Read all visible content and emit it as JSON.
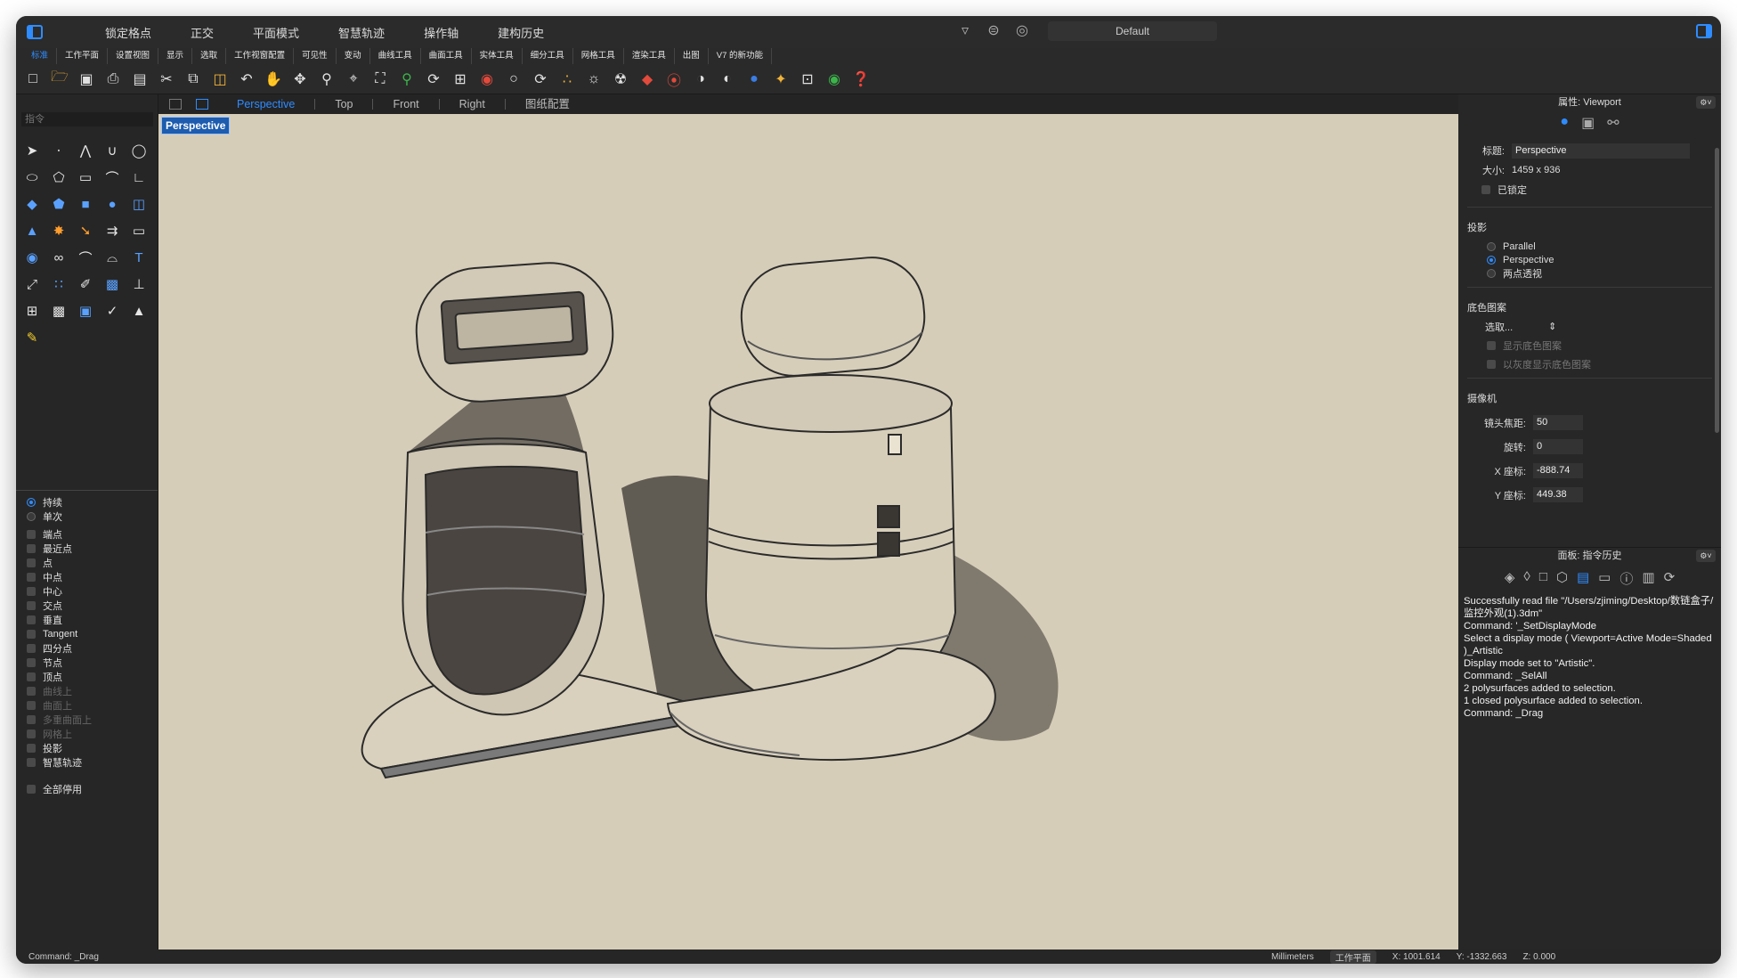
{
  "titlebar": {
    "menu": [
      "锁定格点",
      "正交",
      "平面模式",
      "智慧轨迹",
      "操作轴",
      "建构历史"
    ],
    "preset": "Default"
  },
  "tabs": [
    "标准",
    "工作平面",
    "设置视图",
    "显示",
    "选取",
    "工作视窗配置",
    "可见性",
    "变动",
    "曲线工具",
    "曲面工具",
    "实体工具",
    "细分工具",
    "网格工具",
    "渲染工具",
    "出图",
    "V7 的新功能"
  ],
  "toolbar_icons": [
    "new-icon",
    "open-icon",
    "save-icon",
    "print-icon",
    "paste-icon",
    "cut-icon",
    "copy-icon",
    "clipboard-icon",
    "undo-icon",
    "pan-hand-icon",
    "rotate-view-icon",
    "zoom-icon",
    "zoom-window-icon",
    "zoom-extents-icon",
    "zoom-selected-icon",
    "undo-view-icon",
    "four-viewports-icon",
    "car-icon",
    "car-shaded-icon",
    "rotate-icon",
    "points-icon",
    "light-icon",
    "lock-icon",
    "material-icon",
    "color-wheel-icon",
    "sphere-icon",
    "render-sphere-icon",
    "blue-sphere-icon",
    "plugin-icon",
    "grid-snap-icon",
    "globe-icon",
    "help-icon"
  ],
  "left": {
    "command_placeholder": "指令",
    "snap_modes": [
      {
        "label": "持续",
        "type": "radio",
        "on": true
      },
      {
        "label": "单次",
        "type": "radio",
        "on": false
      }
    ],
    "osnaps": [
      {
        "label": "端点",
        "dim": false
      },
      {
        "label": "最近点",
        "dim": false
      },
      {
        "label": "点",
        "dim": false
      },
      {
        "label": "中点",
        "dim": false
      },
      {
        "label": "中心",
        "dim": false
      },
      {
        "label": "交点",
        "dim": false
      },
      {
        "label": "垂直",
        "dim": false
      },
      {
        "label": "Tangent",
        "dim": false
      },
      {
        "label": "四分点",
        "dim": false
      },
      {
        "label": "节点",
        "dim": false
      },
      {
        "label": "顶点",
        "dim": false
      },
      {
        "label": "曲线上",
        "dim": true
      },
      {
        "label": "曲面上",
        "dim": true
      },
      {
        "label": "多重曲面上",
        "dim": true
      },
      {
        "label": "网格上",
        "dim": true
      },
      {
        "label": "投影",
        "dim": false
      },
      {
        "label": "智慧轨迹",
        "dim": false
      }
    ],
    "disable_all": "全部停用"
  },
  "viewport": {
    "tabs": [
      "Perspective",
      "Top",
      "Front",
      "Right",
      "图纸配置"
    ],
    "active_tab": "Perspective",
    "label": "Perspective",
    "background": "#d6cdb9"
  },
  "properties": {
    "title": "属性: Viewport",
    "title_label": "标题:",
    "title_value": "Perspective",
    "size_label": "大小:",
    "size_value": "1459 x 936",
    "locked_label": "已锁定",
    "projection_head": "投影",
    "projections": [
      {
        "label": "Parallel",
        "on": false
      },
      {
        "label": "Perspective",
        "on": true
      },
      {
        "label": "两点透视",
        "on": false
      }
    ],
    "wallpaper_head": "底色图案",
    "wallpaper_select": "选取...",
    "wallpaper_show": "显示底色图案",
    "wallpaper_gray": "以灰度显示底色图案",
    "camera_head": "摄像机",
    "camera": [
      {
        "label": "镜头焦距:",
        "value": "50"
      },
      {
        "label": "旋转:",
        "value": "0"
      },
      {
        "label": "X 座标:",
        "value": "-888.74"
      },
      {
        "label": "Y 座标:",
        "value": "449.38"
      }
    ]
  },
  "history": {
    "title": "面板: 指令历史",
    "text": "Successfully read file \"/Users/zjiming/Desktop/数链盒子/监控外观(1).3dm\"\nCommand: '_SetDisplayMode\nSelect a display mode ( Viewport=Active Mode=Shaded )_Artistic\nDisplay mode set to \"Artistic\".\nCommand: _SelAll\n2 polysurfaces added to selection.\n1 closed polysurface added to selection.\nCommand: _Drag"
  },
  "status": {
    "command": "Command: _Drag",
    "units": "Millimeters",
    "plane": "工作平面",
    "x": "X: 1001.614",
    "y": "Y: -1332.663",
    "z": "Z: 0.000"
  },
  "colors": {
    "accent": "#2f8cff",
    "label_bg": "#1d5cae"
  }
}
